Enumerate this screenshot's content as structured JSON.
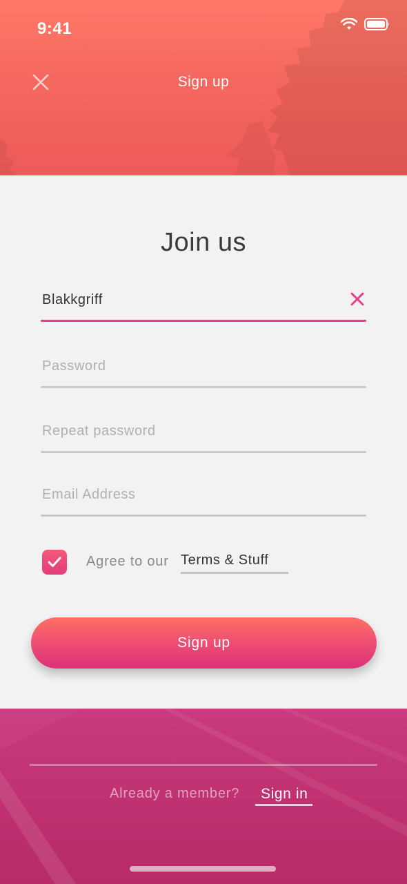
{
  "status_bar": {
    "time": "9:41",
    "icons": [
      "wifi-icon",
      "battery-icon"
    ]
  },
  "header": {
    "title": "Sign up",
    "close_icon": "close-icon"
  },
  "form": {
    "title": "Join us",
    "username": {
      "value": "Blakkgriff",
      "clear_icon": "clear-icon"
    },
    "password": {
      "placeholder": "Password"
    },
    "repeat_password": {
      "placeholder": "Repeat password"
    },
    "email": {
      "placeholder": "Email Address"
    },
    "agree": {
      "checked": true,
      "label": "Agree to our",
      "link": "Terms & Stuff"
    },
    "submit_label": "Sign up"
  },
  "footer": {
    "question": "Already a member?",
    "signin_label": "Sign in"
  },
  "colors": {
    "accent": "#e83e85",
    "header_top": "#ff7867",
    "footer": "#c93a7e"
  }
}
